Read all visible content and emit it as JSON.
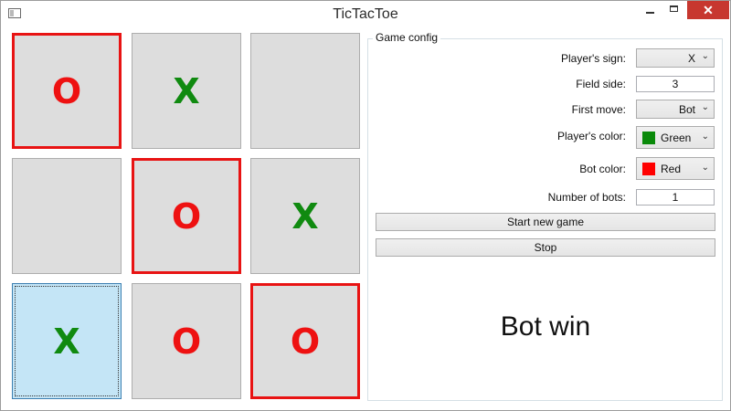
{
  "window": {
    "title": "TicTacToe",
    "close_glyph": "✕"
  },
  "colors": {
    "x_color": "#108a10",
    "o_color": "#ee1111",
    "win_border": "#e81313",
    "focus_bg": "#c4e5f6"
  },
  "board": {
    "cells": [
      "O",
      "X",
      "",
      "",
      "O",
      "X",
      "X",
      "O",
      "O"
    ]
  },
  "config": {
    "group_label": "Game config",
    "players_sign": {
      "label": "Player's sign:",
      "value": "X"
    },
    "field_side": {
      "label": "Field side:",
      "value": "3"
    },
    "first_move": {
      "label": "First move:",
      "value": "Bot"
    },
    "players_color": {
      "label": "Player's color:",
      "value": "Green",
      "swatch": "#0a8a0a"
    },
    "bot_color": {
      "label": "Bot color:",
      "value": "Red",
      "swatch": "#ff0000"
    },
    "number_of_bots": {
      "label": "Number of bots:",
      "value": "1"
    },
    "start_label": "Start new game",
    "stop_label": "Stop",
    "result_text": "Bot win"
  }
}
